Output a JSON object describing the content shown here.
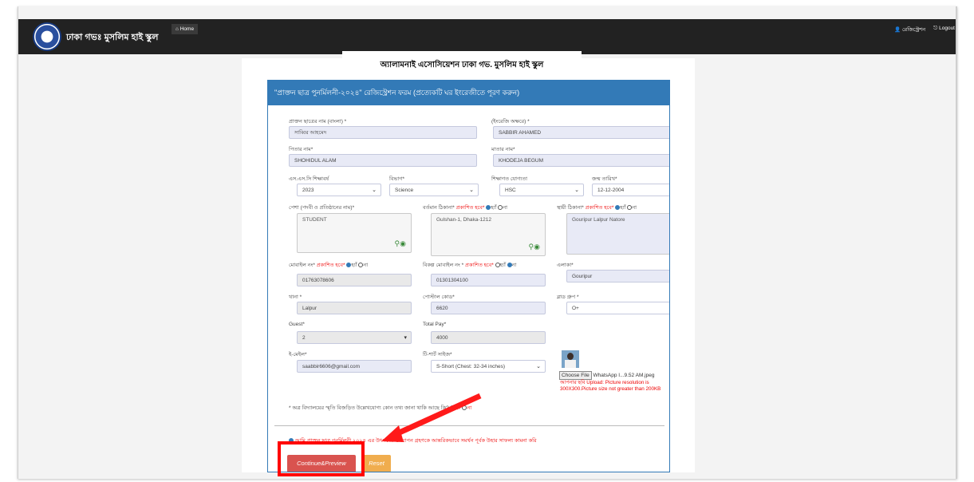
{
  "navbar": {
    "brand": "ঢাকা গভঃ মুসলিম হাই স্কুল",
    "home": "Home",
    "registration": "রেজিস্ট্রেশন",
    "logout": "Logout"
  },
  "header": {
    "title": "অ্যালামনাই এসোসিয়েশন ঢাকা গভ. মুসলিম হাই স্কুল"
  },
  "panel": {
    "heading": "\"প্রাক্তন ছাত্র পুনর্মিলনী-২০২৪\" রেজিস্ট্রেশন ফরম (প্রত্যেকটি ঘর ইংরেজীতে পূরণ করুন)"
  },
  "form": {
    "name_bn_label": "প্রাক্তন ছাত্রের নাম (বাংলা) *",
    "name_bn_value": "সাব্বির আহমেদ",
    "name_en_label": "(ইংরেজি অক্ষরে) *",
    "name_en_value": "SABBIR AHAMED",
    "father_label": "পিতার নাম*",
    "father_value": "SHOHIDUL ALAM",
    "mother_label": "মাতার নাম*",
    "mother_value": "KHODEJA BEGUM",
    "ssc_year_label": "এস.এস.সি শিক্ষাবর্ষ",
    "ssc_year_value": "2023",
    "group_label": "বিভাগ*",
    "group_value": "Science",
    "education_label": "শিক্ষাগত যোগ্যতা",
    "education_value": "HSC",
    "dob_label": "জন্ম তারিখ*",
    "dob_value": "12-12-2004",
    "profession_label": "পেশা (পদবী ও প্রতিষ্ঠানের নাম)*",
    "profession_value": "STUDENT",
    "present_addr_label": "বর্তমান ঠিকানা*",
    "present_addr_publish": "প্রকাশিত হবে*",
    "present_addr_value": "Gulshan-1, Dhaka-1212",
    "permanent_addr_label": "স্থায়ী ঠিকানা*",
    "permanent_addr_publish": "প্রকাশিত হবে*",
    "permanent_addr_value": "Gouripur Lalpur Natore",
    "mobile_label": "মোবাইল নং*",
    "mobile_publish": "প্রকাশিত হবে*",
    "mobile_value": "01763078606",
    "alt_mobile_label": "বিকল্প মোবাইল নং *",
    "alt_mobile_publish": "প্রকাশিত হবে*",
    "alt_mobile_value": "01301304100",
    "area_label": "এলাকা*",
    "area_value": "Gouripur",
    "thana_label": "থানা *",
    "thana_value": "Lalpur",
    "postal_label": "পোস্টাল কোড*",
    "postal_value": "6620",
    "blood_label": "ব্লাড গ্রুপ *",
    "blood_value": "O+",
    "guest_label": "Guest*",
    "guest_value": "2",
    "total_pay_label": "Total Pay*",
    "total_pay_value": "4000",
    "email_label": "ই-মেইল*",
    "email_value": "saabbir6606@gmail.com",
    "tshirt_label": "টি-শার্ট সাইজ*",
    "tshirt_value": "S-Short (Chest: 32-34 inches)",
    "choose_file": "Choose File",
    "file_name": "WhatsApp I...9.52 AM.jpeg",
    "upload_note": "আপনার ছবি Upload: Picture resolution is 300X300.Picture size not greater than 200KB",
    "yes": "হ্যাঁ",
    "no": "না",
    "question": "* অত্র বিদ্যালয়ের স্মৃতি বিজড়িত উল্লেখযোগ্য কোন তথ্য জানা থাকি আছে কি?",
    "agree": "আমি প্রাক্তন ছাত্র পুনর্মিলনী ২০২৪ এর উৎসবের উদযাপন গ্রহণকে আন্তরিকভাবে সমর্থন পূর্বক উহার সাফল্য কামনা করি",
    "continue": "Continue&Preview",
    "reset": "Reset"
  }
}
